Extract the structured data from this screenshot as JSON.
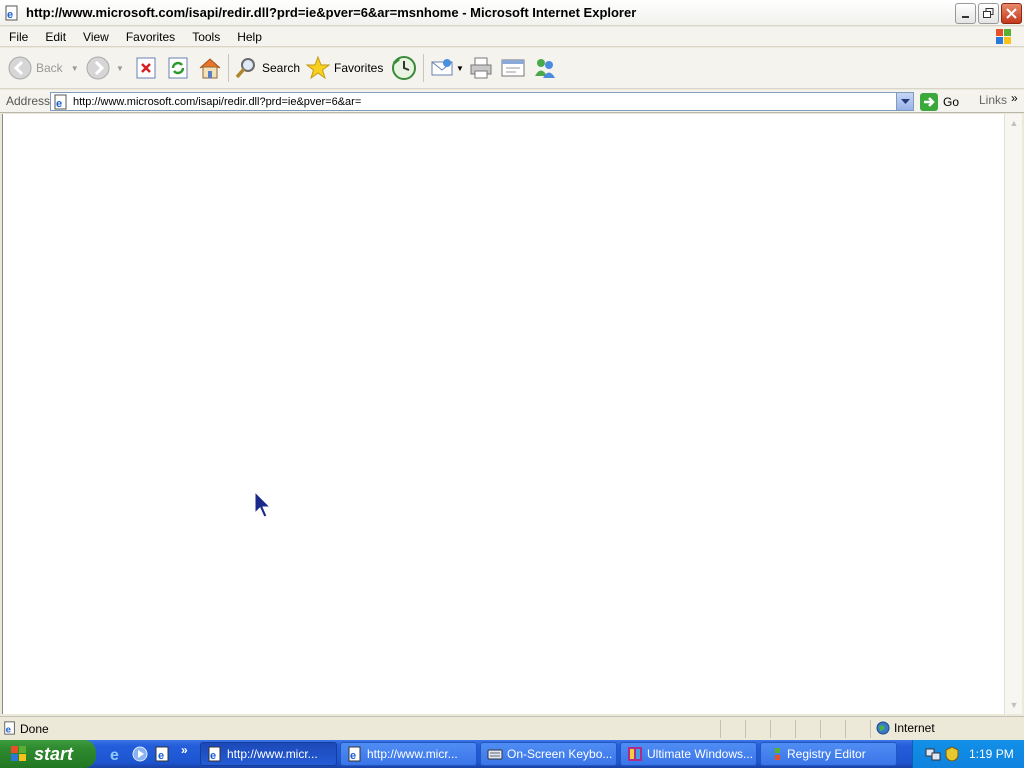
{
  "window": {
    "title": "http://www.microsoft.com/isapi/redir.dll?prd=ie&pver=6&ar=msnhome - Microsoft Internet Explorer"
  },
  "menu": {
    "items": [
      "File",
      "Edit",
      "View",
      "Favorites",
      "Tools",
      "Help"
    ]
  },
  "toolbar": {
    "back_label": "Back",
    "search_label": "Search",
    "favorites_label": "Favorites"
  },
  "address": {
    "label": "Address",
    "url": "http://www.microsoft.com/isapi/redir.dll?prd=ie&pver=6&ar=",
    "go_label": "Go",
    "links_label": "Links",
    "chevron": "»"
  },
  "status": {
    "text": "Done",
    "zone": "Internet"
  },
  "taskbar": {
    "start_label": "start",
    "more_chevron": "»",
    "tasks": [
      {
        "label": "http://www.micr...",
        "active": true
      },
      {
        "label": "http://www.micr...",
        "active": false
      },
      {
        "label": "On-Screen Keybo...",
        "active": false
      },
      {
        "label": "Ultimate Windows...",
        "active": false
      },
      {
        "label": "Registry Editor",
        "active": false
      }
    ],
    "clock": "1:19 PM"
  },
  "colors": {
    "taskbar_blue": "#245edb",
    "start_green": "#2f8a2f",
    "tray_blue": "#0f82de"
  }
}
